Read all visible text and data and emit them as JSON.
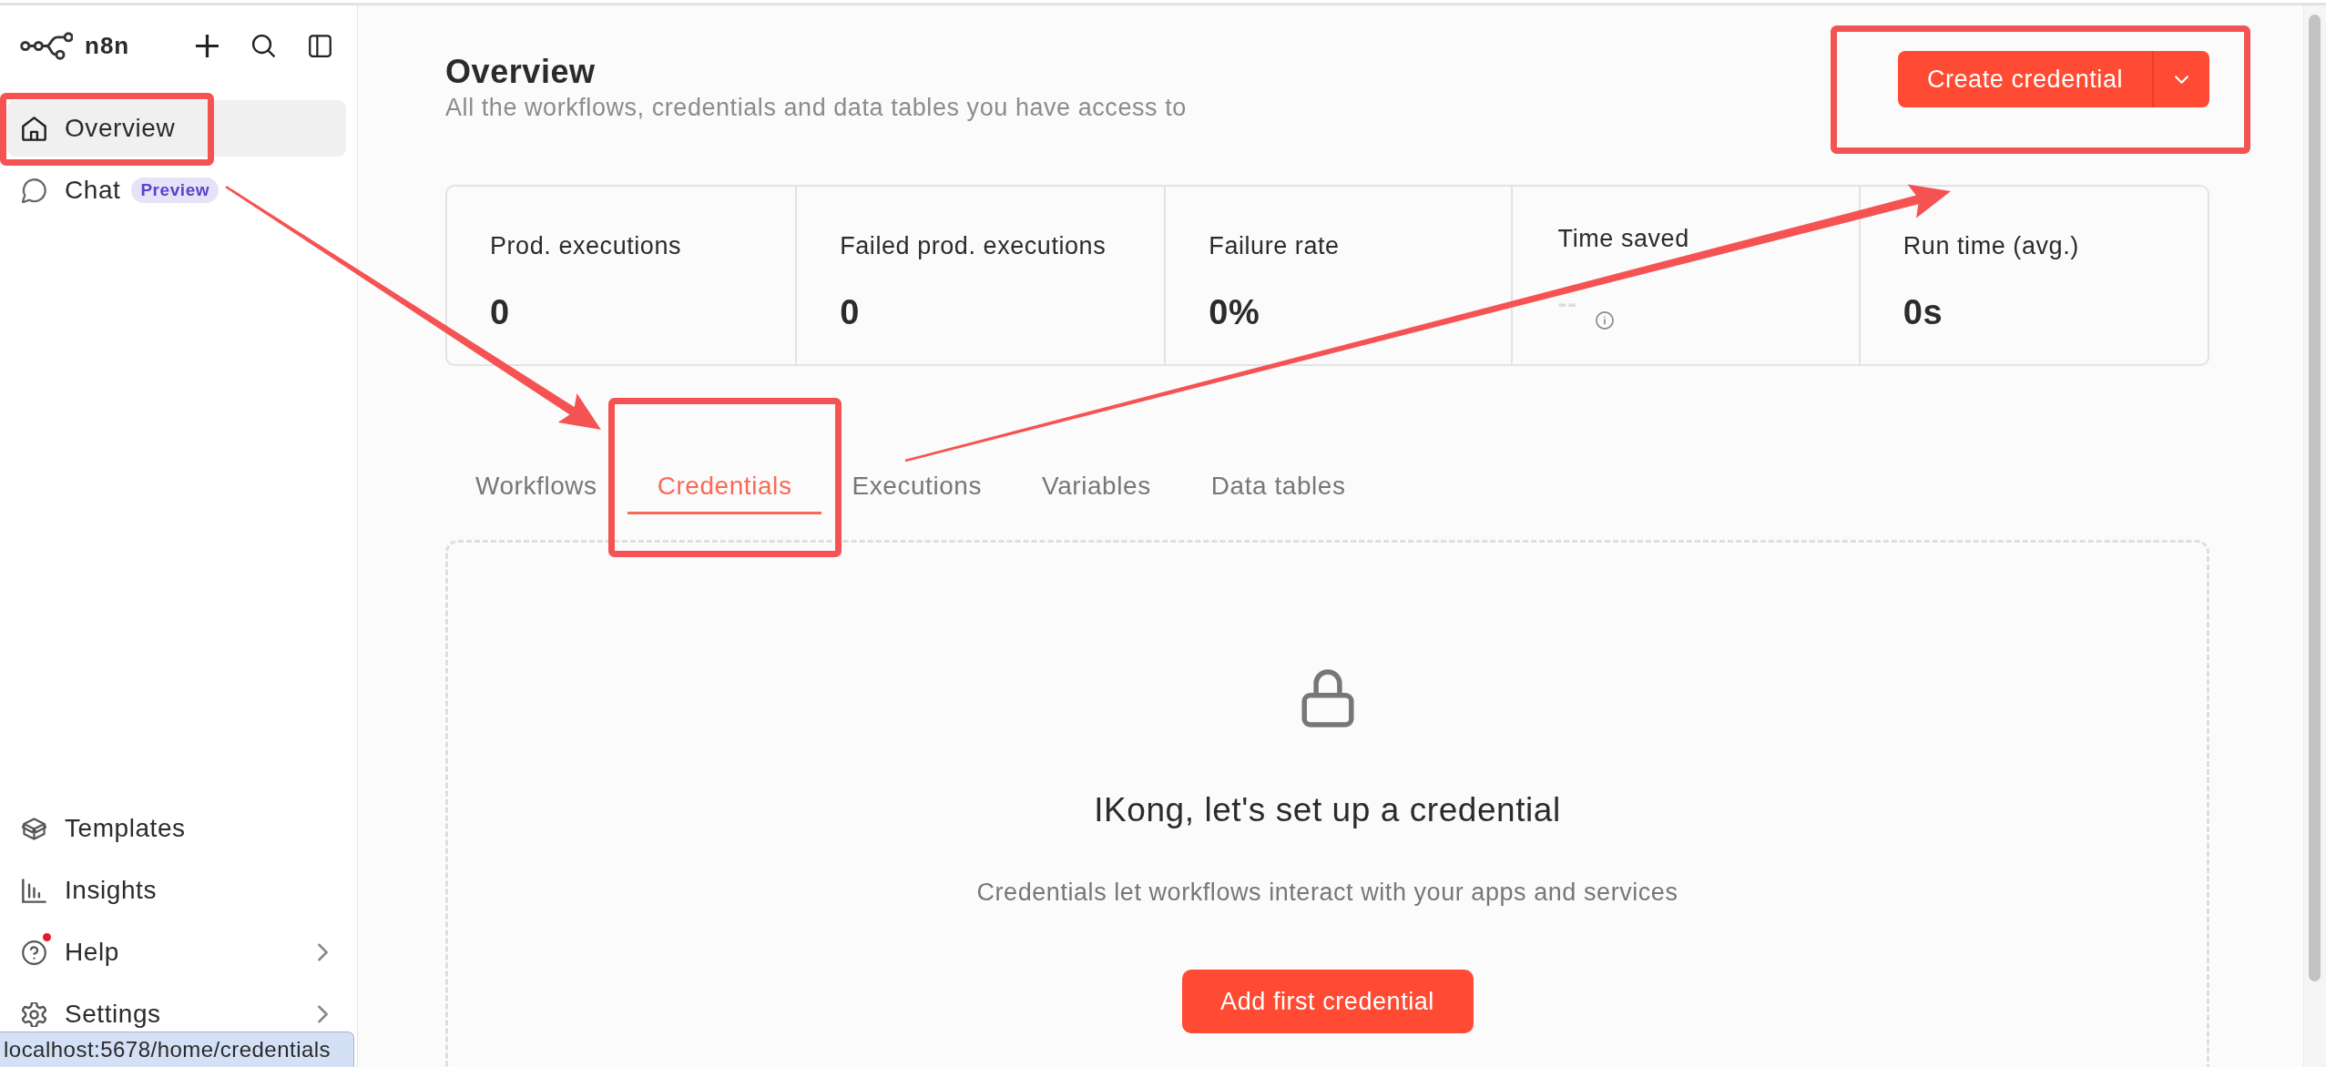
{
  "sidebar": {
    "logo": {
      "text": "n8n"
    },
    "nav_items": [
      {
        "label": "Overview",
        "selected": true
      },
      {
        "label": "Chat",
        "selected": false,
        "badge": "Preview"
      }
    ],
    "bottom_items": [
      {
        "label": "Templates",
        "kind": "link",
        "notification": false
      },
      {
        "label": "Insights",
        "kind": "link",
        "notification": false
      },
      {
        "label": "Help",
        "kind": "submenu",
        "notification": true
      },
      {
        "label": "Settings",
        "kind": "submenu",
        "notification": false
      }
    ]
  },
  "header": {
    "title": "Overview",
    "subtitle": "All the workflows, credentials and data tables you have access to",
    "primary_button": {
      "label": "Create credential"
    }
  },
  "stats": [
    {
      "label": "Prod. executions",
      "value": "0",
      "dimmed": false,
      "info": false
    },
    {
      "label": "Failed prod. executions",
      "value": "0",
      "dimmed": false,
      "info": false
    },
    {
      "label": "Failure rate",
      "value": "0%",
      "dimmed": false,
      "info": false
    },
    {
      "label": "Time saved",
      "value": "--",
      "dimmed": true,
      "info": true
    },
    {
      "label": "Run time (avg.)",
      "value": "0s",
      "dimmed": false,
      "info": false
    }
  ],
  "tabs": [
    {
      "label": "Workflows",
      "selected": false
    },
    {
      "label": "Credentials",
      "selected": true
    },
    {
      "label": "Executions",
      "selected": false
    },
    {
      "label": "Variables",
      "selected": false
    },
    {
      "label": "Data tables",
      "selected": false
    }
  ],
  "empty_state": {
    "title": "IKong, let's set up a credential",
    "description": "Credentials let workflows interact with your apps and services",
    "button": "Add first credential"
  },
  "status_url": "localhost:5678/home/credentials",
  "annotations": [
    {
      "kind": "box"
    },
    {
      "kind": "box"
    },
    {
      "kind": "box"
    },
    {
      "kind": "arrow"
    },
    {
      "kind": "arrow"
    }
  ]
}
